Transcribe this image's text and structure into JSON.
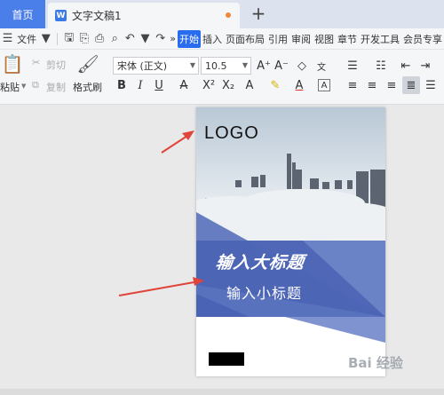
{
  "tabs": {
    "home": "首页",
    "doc_icon": "W",
    "doc_name": "文字文稿1",
    "plus": "+"
  },
  "menu": {
    "file": "文件",
    "more": "»",
    "items": [
      "开始",
      "插入",
      "页面布局",
      "引用",
      "审阅",
      "视图",
      "章节",
      "开发工具",
      "会员专享"
    ]
  },
  "ribbon": {
    "paste": "粘贴",
    "cut": "剪切",
    "copy": "复制",
    "format_painter": "格式刷",
    "font_name": "宋体 (正文)",
    "font_size": "10.5"
  },
  "page": {
    "logo": "LOGO",
    "title": "输入大标题",
    "subtitle": "输入小标题"
  },
  "watermark": "Bai 经验",
  "colors": {
    "accent": "#2a6cf0",
    "home_tab": "#4a7ee8",
    "banner": "#4b63b4",
    "arrow": "#e0443a"
  }
}
